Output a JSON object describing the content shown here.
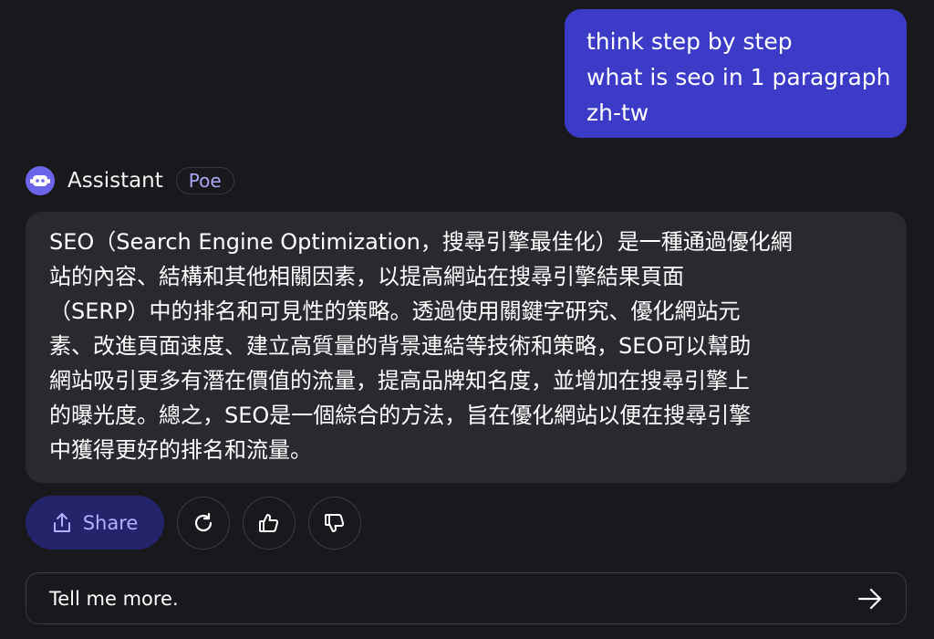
{
  "user_message": {
    "lines": [
      "think step by step",
      "what is seo in 1 paragraph",
      "zh-tw"
    ]
  },
  "bot": {
    "name": "Assistant",
    "badge": "Poe",
    "icon": "robot-icon",
    "accent": "#6a64e8"
  },
  "bot_message": {
    "lines": [
      "SEO（Search Engine Optimization，搜尋引擎最佳化）是一種通過優化網",
      "站的內容、結構和其他相關因素，以提高網站在搜尋引擎結果頁面",
      "（SERP）中的排名和可見性的策略。透過使用關鍵字研究、優化網站元",
      "素、改進頁面速度、建立高質量的背景連結等技術和策略，SEO可以幫助",
      "網站吸引更多有潛在價值的流量，提高品牌知名度，並增加在搜尋引擎上",
      "的曝光度。總之，SEO是一個綜合的方法，旨在優化網站以便在搜尋引擎",
      "中獲得更好的排名和流量。"
    ]
  },
  "actions": {
    "share_label": "Share",
    "share_icon": "share-icon",
    "retry_icon": "refresh-icon",
    "like_icon": "thumbs-up-icon",
    "dislike_icon": "thumbs-down-icon"
  },
  "composer": {
    "value": "Tell me more.",
    "send_icon": "arrow-right-icon"
  },
  "colors": {
    "background": "#19181c",
    "user_bubble": "#3b3bc7",
    "bot_bubble": "#2a292f",
    "share_button": "#24246a",
    "share_text": "#b3b0ff"
  }
}
